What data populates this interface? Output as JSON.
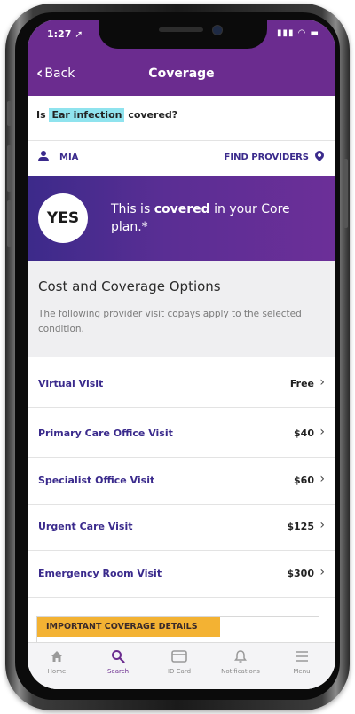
{
  "status_bar": {
    "time": "1:27 ➚",
    "icons": "▮▮▮ ◠ ▬"
  },
  "nav": {
    "back_label": "Back",
    "title": "Coverage"
  },
  "question": {
    "prefix": "Is",
    "condition": "Ear infection",
    "suffix": "covered?"
  },
  "member": {
    "name": "MIA",
    "find_providers_label": "FIND PROVIDERS"
  },
  "banner": {
    "badge": "YES",
    "text_before": "This is ",
    "text_bold": "covered",
    "text_after": " in your Core plan.*"
  },
  "cost_section": {
    "heading": "Cost and Coverage Options",
    "description": "The following provider visit copays apply to the selected condition."
  },
  "visits": [
    {
      "label": "Virtual Visit",
      "price": "Free"
    },
    {
      "label": "Primary Care Office Visit",
      "price": "$40"
    },
    {
      "label": "Specialist Office Visit",
      "price": "$60"
    },
    {
      "label": "Urgent Care Visit",
      "price": "$125"
    },
    {
      "label": "Emergency Room Visit",
      "price": "$300"
    }
  ],
  "details_tag": "IMPORTANT COVERAGE DETAILS",
  "tabs": [
    {
      "label": "Home",
      "icon": "home-icon"
    },
    {
      "label": "Search",
      "icon": "search-icon",
      "active": true
    },
    {
      "label": "ID Card",
      "icon": "id-card-icon"
    },
    {
      "label": "Notifications",
      "icon": "bell-icon"
    },
    {
      "label": "Menu",
      "icon": "menu-icon"
    }
  ],
  "colors": {
    "brand_purple": "#6b2c8f",
    "link_indigo": "#3a2a8c",
    "highlight": "#8fe3ee",
    "tag_gold": "#f3b233"
  }
}
